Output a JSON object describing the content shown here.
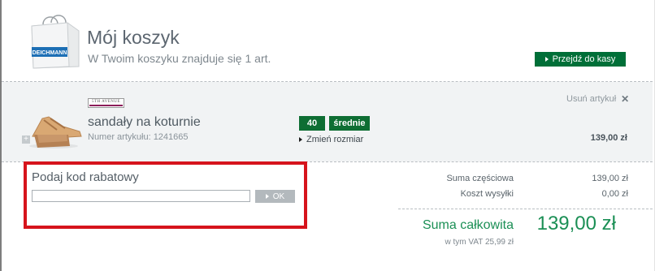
{
  "header": {
    "brand": "DEICHMANN",
    "title": "Mój koszyk",
    "subtitle": "W Twoim koszyku znajduje się 1 art.",
    "checkout_label": "Przejdź do kasy"
  },
  "product": {
    "brand_logo": "5TH AVENUE",
    "name": "sandały na koturnie",
    "article_number": "Numer artykułu: 1241665",
    "size": "40",
    "width": "średnie",
    "change_size_label": "Zmień rozmiar",
    "remove_label": "Usuń artykuł",
    "price": "139,00 zł"
  },
  "voucher": {
    "title": "Podaj kod rabatowy",
    "value": "",
    "button_label": "OK"
  },
  "totals": {
    "subtotal_label": "Suma częściowa",
    "subtotal_value": "139,00 zł",
    "shipping_label": "Koszt wysyłki",
    "shipping_value": "0,00 zł",
    "total_label": "Suma całkowita",
    "total_value": "139,00 zł",
    "vat_label": "w tym VAT  25,99 zł"
  },
  "colors": {
    "accent_green": "#006f38",
    "total_green": "#1b8f55",
    "highlight_red": "#d6141c"
  }
}
